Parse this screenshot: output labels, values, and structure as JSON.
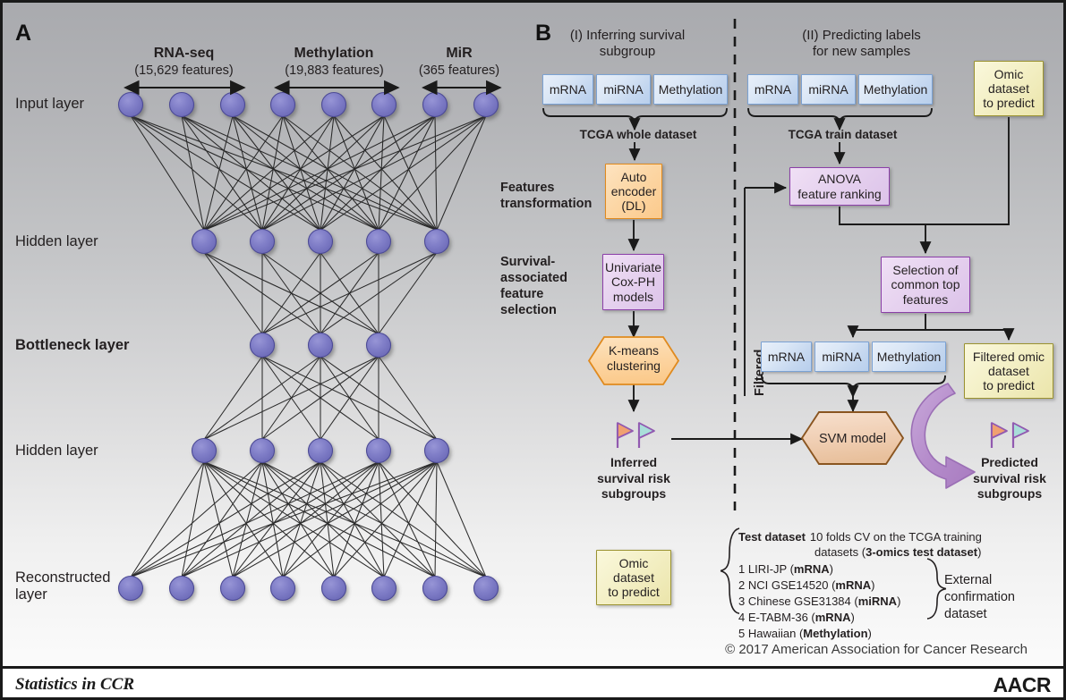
{
  "panelA": {
    "letter": "A",
    "omics": [
      {
        "title": "RNA-seq",
        "features": "(15,629 features)"
      },
      {
        "title": "Methylation",
        "features": "(19,883 features)"
      },
      {
        "title": "MiR",
        "features": "(365 features)"
      }
    ],
    "layers": [
      {
        "name": "Input layer",
        "bold": false,
        "nodes": 8
      },
      {
        "name": "Hidden layer",
        "bold": false,
        "nodes": 5
      },
      {
        "name": "Bottleneck layer",
        "bold": true,
        "nodes": 3
      },
      {
        "name": "Hidden layer",
        "bold": false,
        "nodes": 5
      },
      {
        "name": "Reconstructed\nlayer",
        "bold": false,
        "nodes": 8
      }
    ],
    "node_color": "#7a78c2"
  },
  "panelB": {
    "letter": "B",
    "headings": {
      "left": "(I) Inferring survival\nsubgroup",
      "right": "(II) Predicting labels\nfor new samples"
    },
    "stage_labels": {
      "features_transformation": "Features\ntransformation",
      "feature_selection": "Survival-\nassociated\nfeature\nselection",
      "filtered": "Filtered"
    },
    "omic_boxes_left": [
      "mRNA",
      "miRNA",
      "Methylation"
    ],
    "omic_boxes_right": [
      "mRNA",
      "miRNA",
      "Methylation"
    ],
    "omic_boxes_filtered": [
      "mRNA",
      "miRNA",
      "Methylation"
    ],
    "dataset_labels": {
      "left": "TCGA whole dataset",
      "right": "TCGA train dataset"
    },
    "nodes": {
      "autoencoder": "Auto\nencoder\n(DL)",
      "coxph": "Univariate\nCox-PH\nmodels",
      "kmeans": "K-means\nclustering",
      "anova": "ANOVA\nfeature ranking",
      "selection": "Selection of\ncommon top\nfeatures",
      "omic_predict_top": "Omic\ndataset\nto predict",
      "filtered_omic": "Filtered omic\ndataset\nto predict",
      "svm": "SVM model",
      "omic_predict_bottom": "Omic\ndataset\nto predict"
    },
    "results": {
      "inferred": "Inferred\nsurvival risk\nsubgroups",
      "predicted": "Predicted\nsurvival risk\nsubgroups"
    },
    "colors": {
      "blue_box_border": "#7ba2d4",
      "orange_border": "#e08a1e",
      "purple_border": "#8b3fa8",
      "yellow_border": "#9a9230",
      "svm_border": "#8a5520",
      "arrow_purple": "#b58ccb",
      "flag_risk_high": "#f0a070",
      "flag_risk_low": "#a9ded9"
    }
  },
  "legend": {
    "test_dataset_label": "Test dataset",
    "test_dataset_desc_line1": "10 folds CV on the TCGA training",
    "test_dataset_desc_line2_pre": "datasets (",
    "test_dataset_desc_line2_bold": "3-omics test dataset",
    "test_dataset_desc_line2_post": ")",
    "items": [
      {
        "num": "1",
        "name": "LIRI-JP (",
        "omic": "mRNA",
        "tail": ")"
      },
      {
        "num": "2",
        "name": "NCI GSE14520 (",
        "omic": "mRNA",
        "tail": ")"
      },
      {
        "num": "3",
        "name": "Chinese GSE31384 (",
        "omic": "miRNA",
        "tail": ")"
      },
      {
        "num": "4",
        "name": "E-TABM-36 (",
        "omic": "mRNA",
        "tail": ")"
      },
      {
        "num": "5",
        "name": "Hawaiian (",
        "omic": "Methylation",
        "tail": ")"
      }
    ],
    "external_label": "External\nconfirmation\ndataset"
  },
  "copyright": "© 2017 American Association for Cancer Research",
  "footer": {
    "journal_section": "Statistics in CCR",
    "publisher": "AACR"
  }
}
